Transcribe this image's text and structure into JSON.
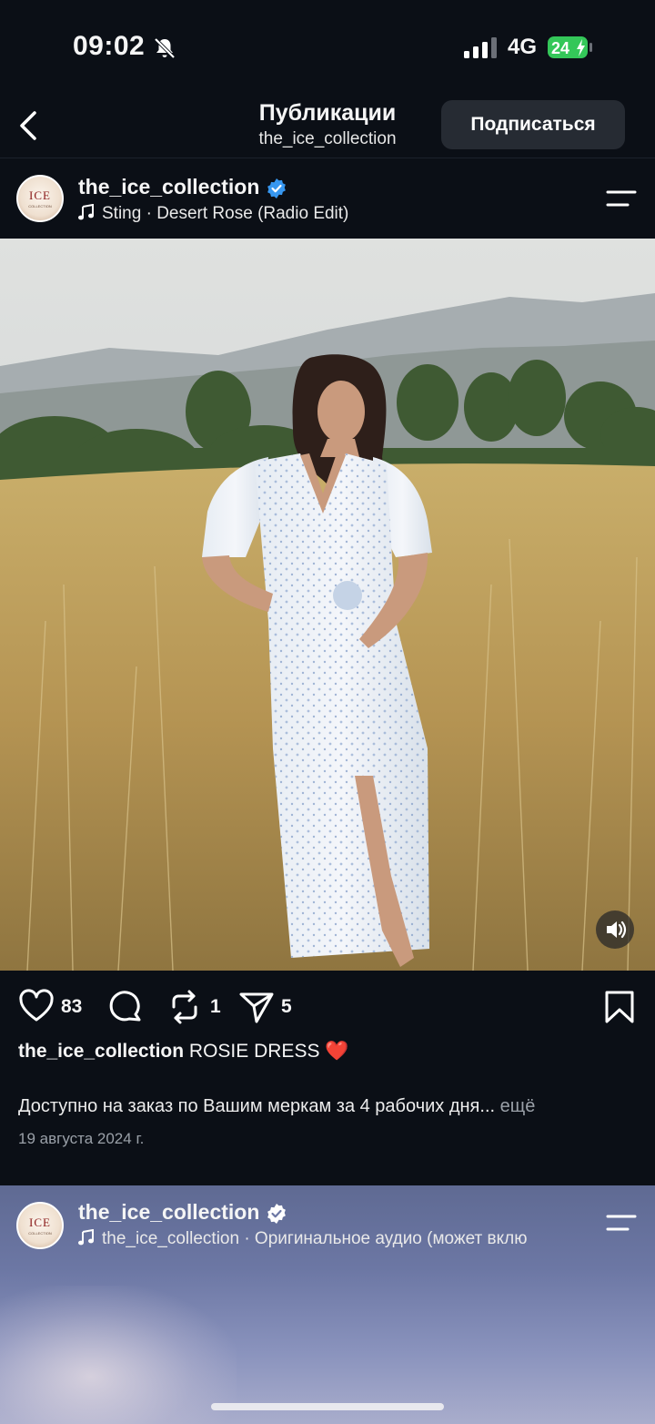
{
  "status_bar": {
    "time": "09:02",
    "network": "4G",
    "battery": "24"
  },
  "header": {
    "title": "Публикации",
    "subtitle": "the_ice_collection",
    "subscribe_label": "Подписаться"
  },
  "post": {
    "avatar_text": "ICE",
    "avatar_subtext": "COLLECTION",
    "username": "the_ice_collection",
    "music": "Sting · Desert Rose (Radio Edit)",
    "likes": "83",
    "reposts": "1",
    "shares": "5",
    "caption_user": "the_ice_collection",
    "caption_text": "ROSIE DRESS ❤️",
    "description": "Доступно на заказ по Вашим меркам за 4 рабочих дня...",
    "more_label": "ещё",
    "date": "19 августа 2024 г."
  },
  "next_post": {
    "username": "the_ice_collection",
    "music": "the_ice_collection · Оригинальное аудио  (может вклю"
  },
  "colors": {
    "background": "#0b0f16",
    "verified": "#3797f0",
    "battery": "#34c759",
    "subscribe_bg": "#262b33",
    "heart": "#e0202e"
  }
}
